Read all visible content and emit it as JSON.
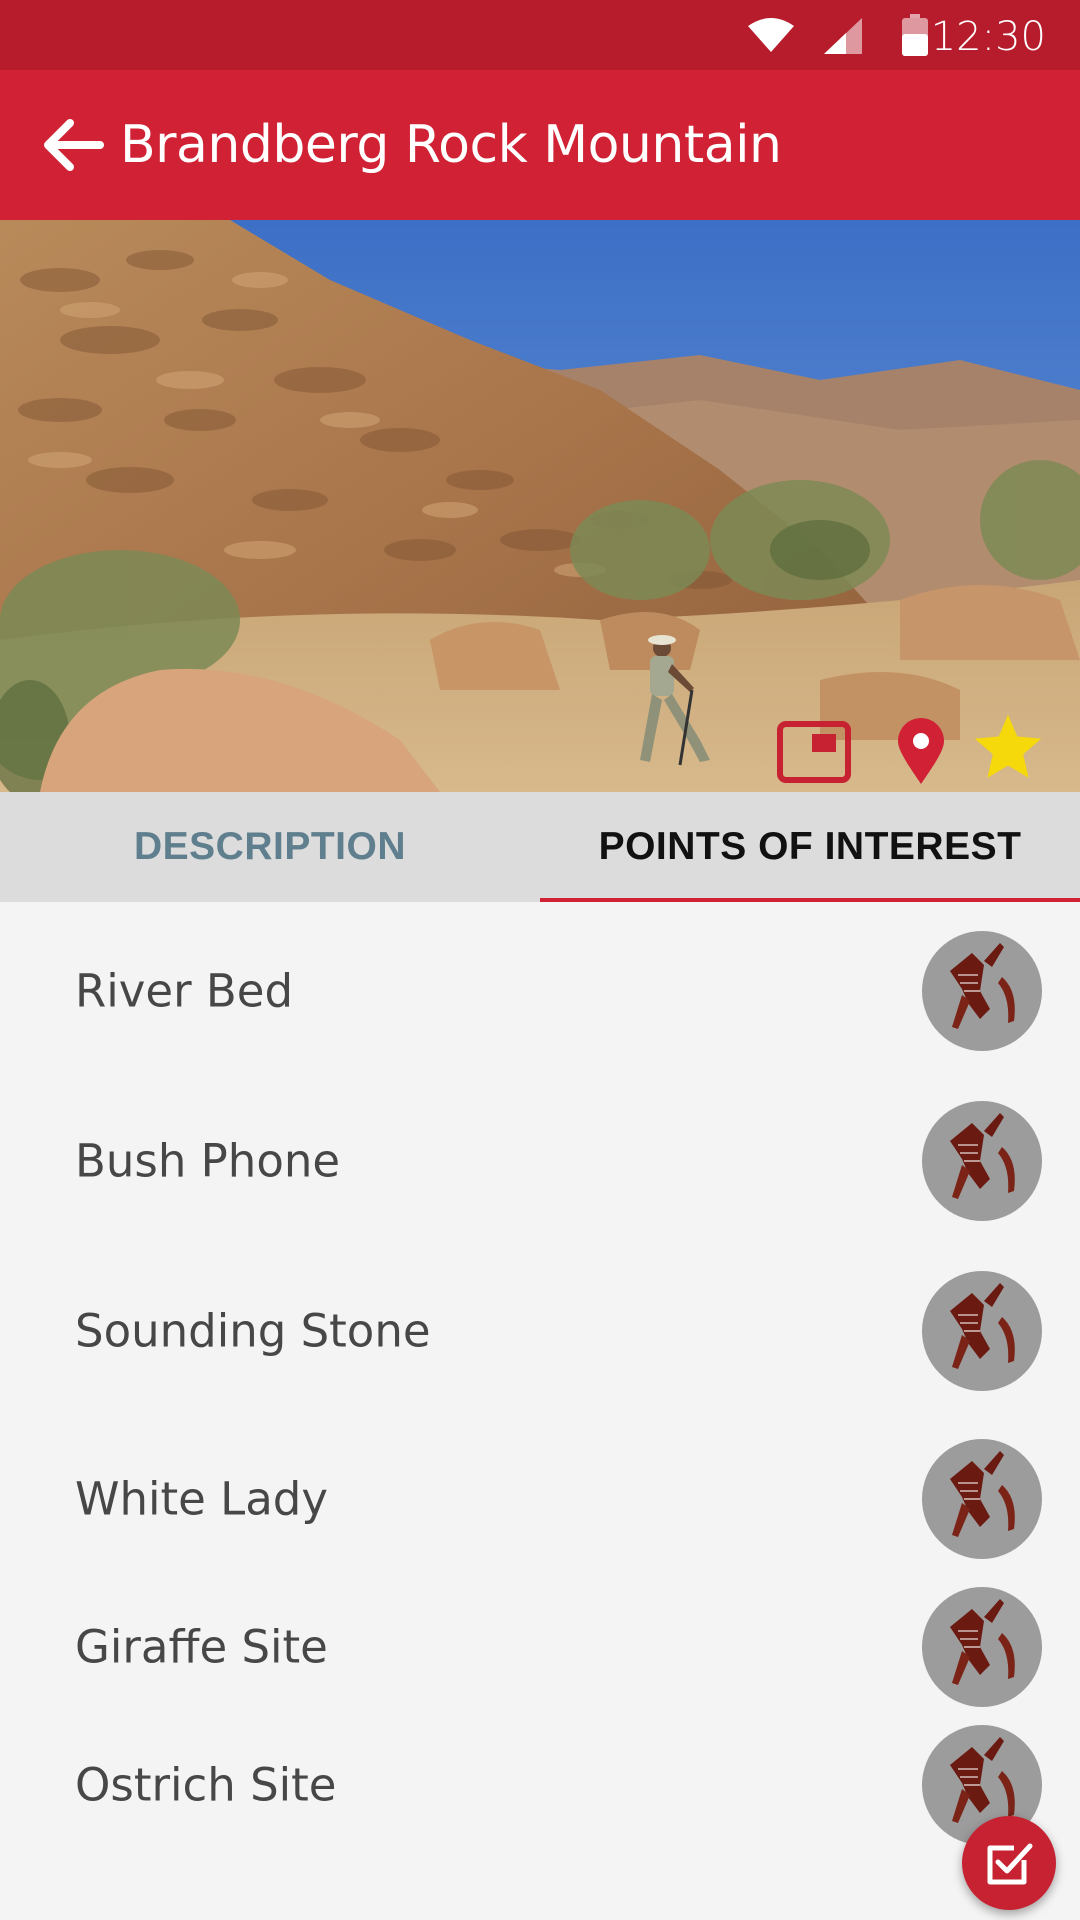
{
  "status_bar": {
    "time": "12:30",
    "icons": [
      "wifi-icon",
      "signal-icon",
      "battery-icon"
    ]
  },
  "app_bar": {
    "title": "Brandberg Rock Mountain",
    "back_icon": "arrow-back-icon"
  },
  "hero": {
    "actions": [
      "slideshow-icon",
      "map-pin-icon",
      "star-icon"
    ]
  },
  "tabs": [
    {
      "label": "DESCRIPTION",
      "selected": false
    },
    {
      "label": "POINTS OF INTEREST",
      "selected": true
    }
  ],
  "points_of_interest": [
    {
      "name": "River Bed"
    },
    {
      "name": "Bush Phone"
    },
    {
      "name": "Sounding Stone"
    },
    {
      "name": "White Lady"
    },
    {
      "name": "Giraffe Site"
    },
    {
      "name": "Ostrich Site"
    }
  ],
  "fab": {
    "icon": "checkbox-icon"
  },
  "colors": {
    "status_bar": "#b71c2c",
    "app_bar": "#d02234",
    "tab_bar": "#dcdcdc",
    "accent": "#d02234",
    "star": "#f5d90b"
  }
}
